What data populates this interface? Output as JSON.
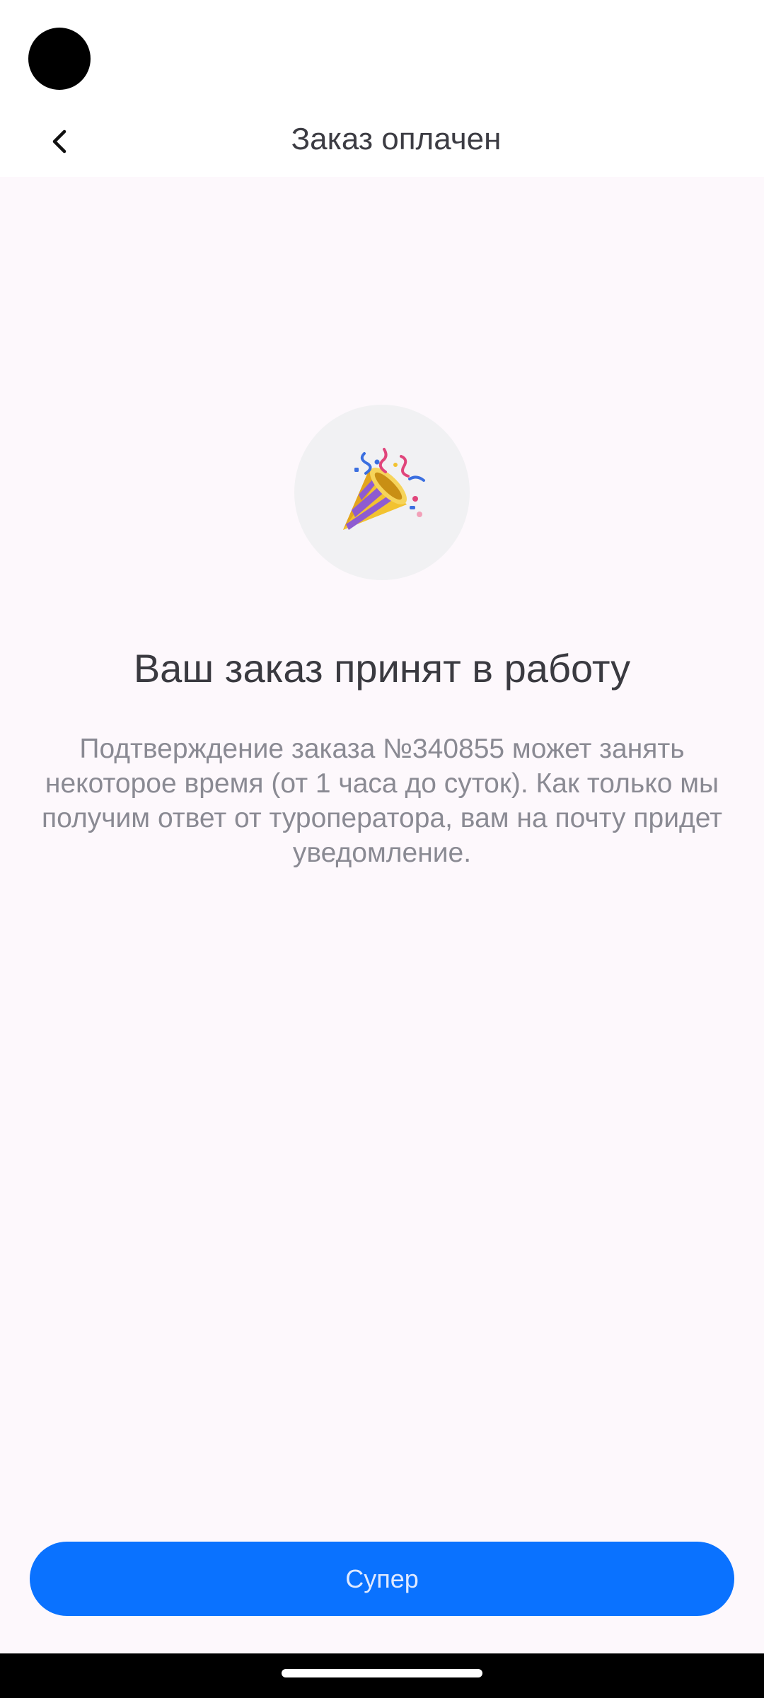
{
  "header": {
    "title": "Заказ оплачен",
    "back_icon": "chevron-left-icon"
  },
  "confirmation": {
    "icon": "party-popper-icon",
    "headline": "Ваш заказ принят в работу",
    "description": "Подтверждение заказа №340855 может занять некоторое время (от 1 часа до суток). Как только мы получим ответ от туроператора, вам на почту придет уведомление."
  },
  "actions": {
    "primary_label": "Супер"
  },
  "colors": {
    "accent": "#0a72ff",
    "background": "#fdf8fc",
    "headline": "#3a3a40",
    "description": "#8a8a93"
  }
}
